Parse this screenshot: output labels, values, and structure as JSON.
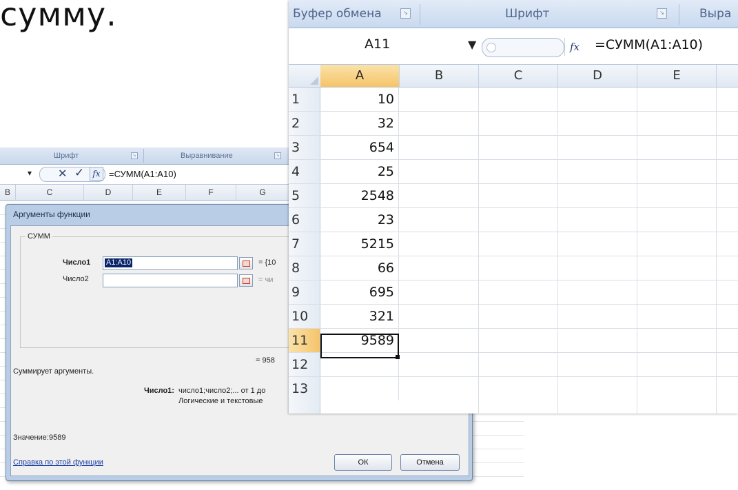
{
  "slide_title": "сумму.",
  "back_window": {
    "ribbon": {
      "font_group": "Шрифт",
      "align_group": "Выравнивание"
    },
    "formula_bar": {
      "formula": "=СУММ(A1:A10)",
      "fx": "fx"
    },
    "columns": [
      "B",
      "C",
      "D",
      "E",
      "F",
      "G"
    ],
    "dialog": {
      "title": "Аргументы функции",
      "function_name": "СУММ",
      "arg1_label": "Число1",
      "arg1_value": "A1:A10",
      "arg1_result": "= {10",
      "arg2_label": "Число2",
      "arg2_result": "= чи",
      "formula_result": "= 958",
      "description": "Суммирует аргументы.",
      "help_label": "Число1:",
      "help_line1": "число1;число2;... от 1 до",
      "help_line2": "Логические и текстовые",
      "value_label": "Значение:",
      "value": "9589",
      "help_link": "Справка по этой функции",
      "ok_button": "ОК",
      "cancel_button": "Отмена"
    }
  },
  "front_window": {
    "ribbon": {
      "clipboard_group": "Буфер обмена",
      "font_group": "Шрифт",
      "align_group_partial": "Выра"
    },
    "formula_bar": {
      "name_box": "A11",
      "fx": "fx",
      "formula": "=СУММ(A1:A10)"
    },
    "columns": [
      "A",
      "B",
      "C",
      "D",
      "E"
    ],
    "rows": [
      {
        "num": "1",
        "a": "10"
      },
      {
        "num": "2",
        "a": "32"
      },
      {
        "num": "3",
        "a": "654"
      },
      {
        "num": "4",
        "a": "25"
      },
      {
        "num": "5",
        "a": "2548"
      },
      {
        "num": "6",
        "a": "23"
      },
      {
        "num": "7",
        "a": "5215"
      },
      {
        "num": "8",
        "a": "66"
      },
      {
        "num": "9",
        "a": "695"
      },
      {
        "num": "10",
        "a": "321"
      },
      {
        "num": "11",
        "a": "9589"
      },
      {
        "num": "12",
        "a": ""
      },
      {
        "num": "13",
        "a": ""
      }
    ],
    "active_cell": "A11"
  }
}
